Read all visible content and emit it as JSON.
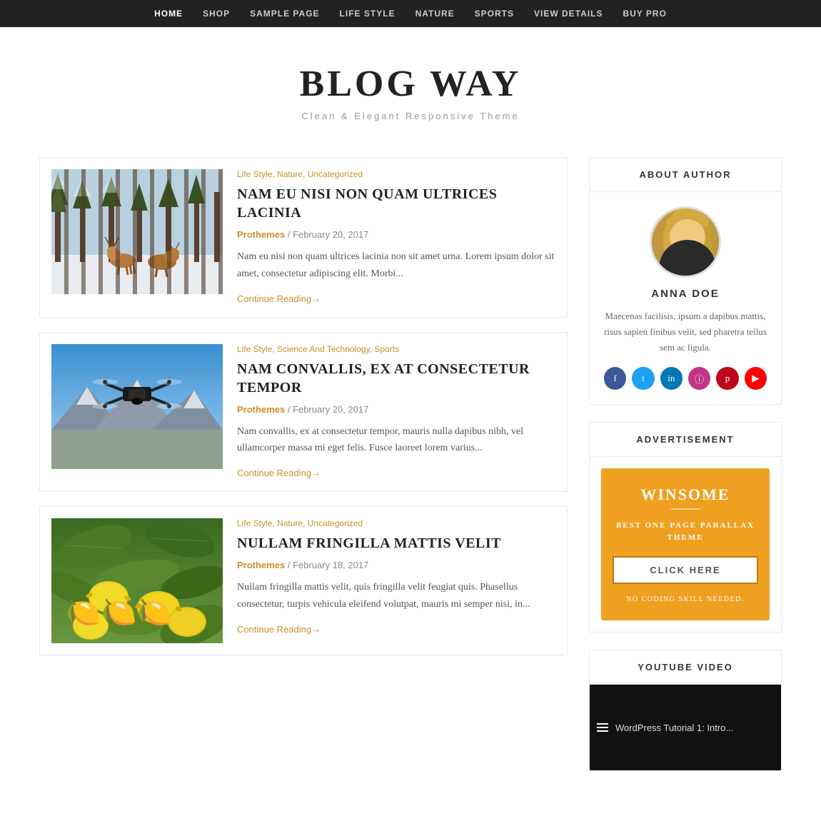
{
  "nav": {
    "items": [
      {
        "label": "HOME",
        "active": true
      },
      {
        "label": "SHOP",
        "active": false
      },
      {
        "label": "SAMPLE PAGE",
        "active": false
      },
      {
        "label": "LIFE STYLE",
        "active": false
      },
      {
        "label": "NATURE",
        "active": false
      },
      {
        "label": "SPORTS",
        "active": false
      },
      {
        "label": "VIEW DETAILS",
        "active": false
      },
      {
        "label": "BUY PRO",
        "active": false
      }
    ]
  },
  "header": {
    "title": "BLOG WAY",
    "tagline": "Clean & Elegant Responsive Theme"
  },
  "articles": [
    {
      "categories": "Life Style, Nature, Uncategorized",
      "title": "NAM EU NISI NON QUAM ULTRICES LACINIA",
      "author": "Prothemes",
      "date": "February 20, 2017",
      "excerpt": "Nam eu nisi non quam ultrices lacinia non sit amet urna. Lorem ipsum dolor sit amet, consectetur adipiscing elit. Morbi...",
      "continue": "Continue Reading→",
      "thumb": "deer"
    },
    {
      "categories": "Life Style, Science And Technology, Sports",
      "title": "NAM CONVALLIS, EX AT CONSECTETUR TEMPOR",
      "author": "Prothemes",
      "date": "February 20, 2017",
      "excerpt": "Nam convallis, ex at consectetur tempor, mauris nulla dapibus nibh, vel ullamcorper massa mi eget felis. Fusce laoreet lorem varius...",
      "continue": "Continue Reading→",
      "thumb": "drone"
    },
    {
      "categories": "Life Style, Nature, Uncategorized",
      "title": "NULLAM FRINGILLA MATTIS VELIT",
      "author": "Prothemes",
      "date": "February 18, 2017",
      "excerpt": "Nullam fringilla mattis velit, quis fringilla velit feugiat quis. Phasellus consectetur, turpis vehicula eleifend volutpat, mauris mi semper nisi, in...",
      "continue": "Continue Reading→",
      "thumb": "lemon"
    }
  ],
  "sidebar": {
    "about": {
      "widget_title": "ABOUT AUTHOR",
      "author_name": "ANNA DOE",
      "author_bio": "Maecenas facilisis, ipsum a dapibus mattis, risus sapien finibus velit, sed pharetra tellus sem ac ligula.",
      "social": [
        "f",
        "t",
        "in",
        "ig",
        "p",
        "▶"
      ]
    },
    "advertisement": {
      "widget_title": "ADVERTISEMENT",
      "ad_title": "WINSOME",
      "ad_subtitle": "BEST ONE PAGE PARALLAX THEME",
      "ad_btn": "CLICK HERE",
      "ad_footnote": "NO CODING SKILL NEEDED."
    },
    "youtube": {
      "widget_title": "YOUTUBE VIDEO",
      "preview_text": "WordPress Tutorial 1: Intro..."
    }
  }
}
